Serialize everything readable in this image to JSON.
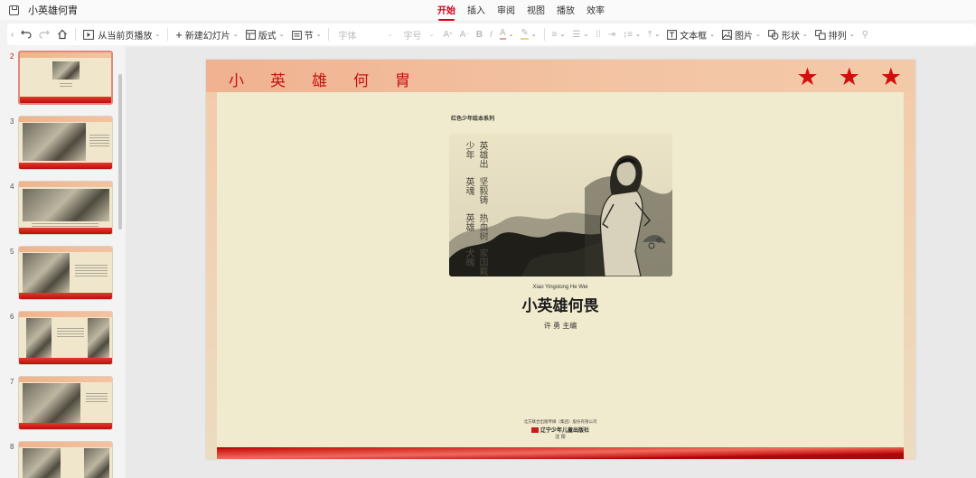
{
  "titlebar": {
    "doc_title": "小英雄何胄"
  },
  "menu_tabs": [
    {
      "label": "开始",
      "active": true
    },
    {
      "label": "插入",
      "active": false
    },
    {
      "label": "审阅",
      "active": false
    },
    {
      "label": "视图",
      "active": false
    },
    {
      "label": "播放",
      "active": false
    },
    {
      "label": "效率",
      "active": false
    }
  ],
  "toolbar": {
    "play_from_current": "从当前页播放",
    "new_slide": "新建幻灯片",
    "layout": "版式",
    "section": "节",
    "font_name": "字体",
    "font_size": "字号",
    "textbox": "文本框",
    "picture": "图片",
    "shape": "形状",
    "arrange": "排列"
  },
  "thumbnails": [
    {
      "number": "2",
      "active": true
    },
    {
      "number": "3",
      "active": false
    },
    {
      "number": "4",
      "active": false
    },
    {
      "number": "5",
      "active": false
    },
    {
      "number": "6",
      "active": false
    },
    {
      "number": "7",
      "active": false
    },
    {
      "number": "8",
      "active": false
    }
  ],
  "slide": {
    "title_chars": [
      "小",
      "英",
      "雄",
      "何",
      "胄"
    ],
    "stars": [
      "★",
      "★",
      "★"
    ],
    "book": {
      "series": "红色少年绘本系列",
      "poem_columns": [
        "家国戴犬魄",
        "热血树英雄",
        "坚毅铸英魂",
        "英雄出少年"
      ],
      "pinyin": "Xiao Yingxiong He Wei",
      "title": "小英雄何畏",
      "editor": "许 勇 主编",
      "publisher_line1": "北方联合出版传媒（集团）股份有限公司",
      "publisher_name": "辽宁少年儿童出版社",
      "publisher_city": "沈 阳"
    }
  },
  "colors": {
    "accent": "#d0021b",
    "slide_title": "#c41212",
    "star": "#d40d0d",
    "paper": "#efe9cd"
  }
}
